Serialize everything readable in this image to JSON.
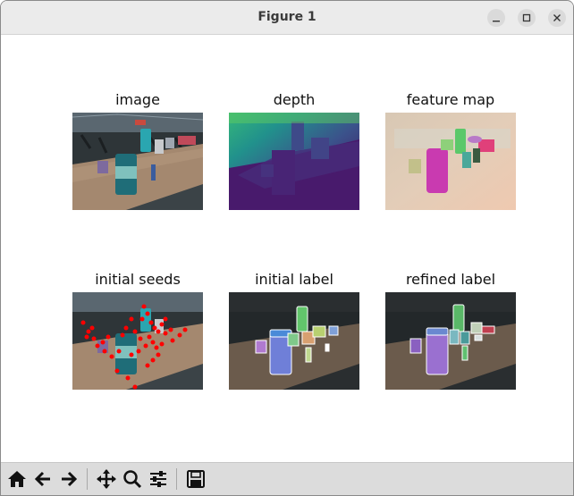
{
  "window": {
    "title": "Figure 1"
  },
  "panels": {
    "image": {
      "title": "image"
    },
    "depth": {
      "title": "depth"
    },
    "feature_map": {
      "title": "feature map"
    },
    "initial_seeds": {
      "title": "initial seeds"
    },
    "initial_label": {
      "title": "initial label"
    },
    "refined_label": {
      "title": "refined label"
    }
  },
  "toolbar": {
    "buttons": [
      "home-icon",
      "back-arrow-icon",
      "forward-arrow-icon",
      "pan-move-icon",
      "zoom-magnifier-icon",
      "configure-subplots-icon",
      "save-floppy-icon"
    ]
  },
  "colors": {
    "titlebar": "#ebebeb",
    "toolbar": "#dcdcdc",
    "seed_red": "#ff0000"
  }
}
